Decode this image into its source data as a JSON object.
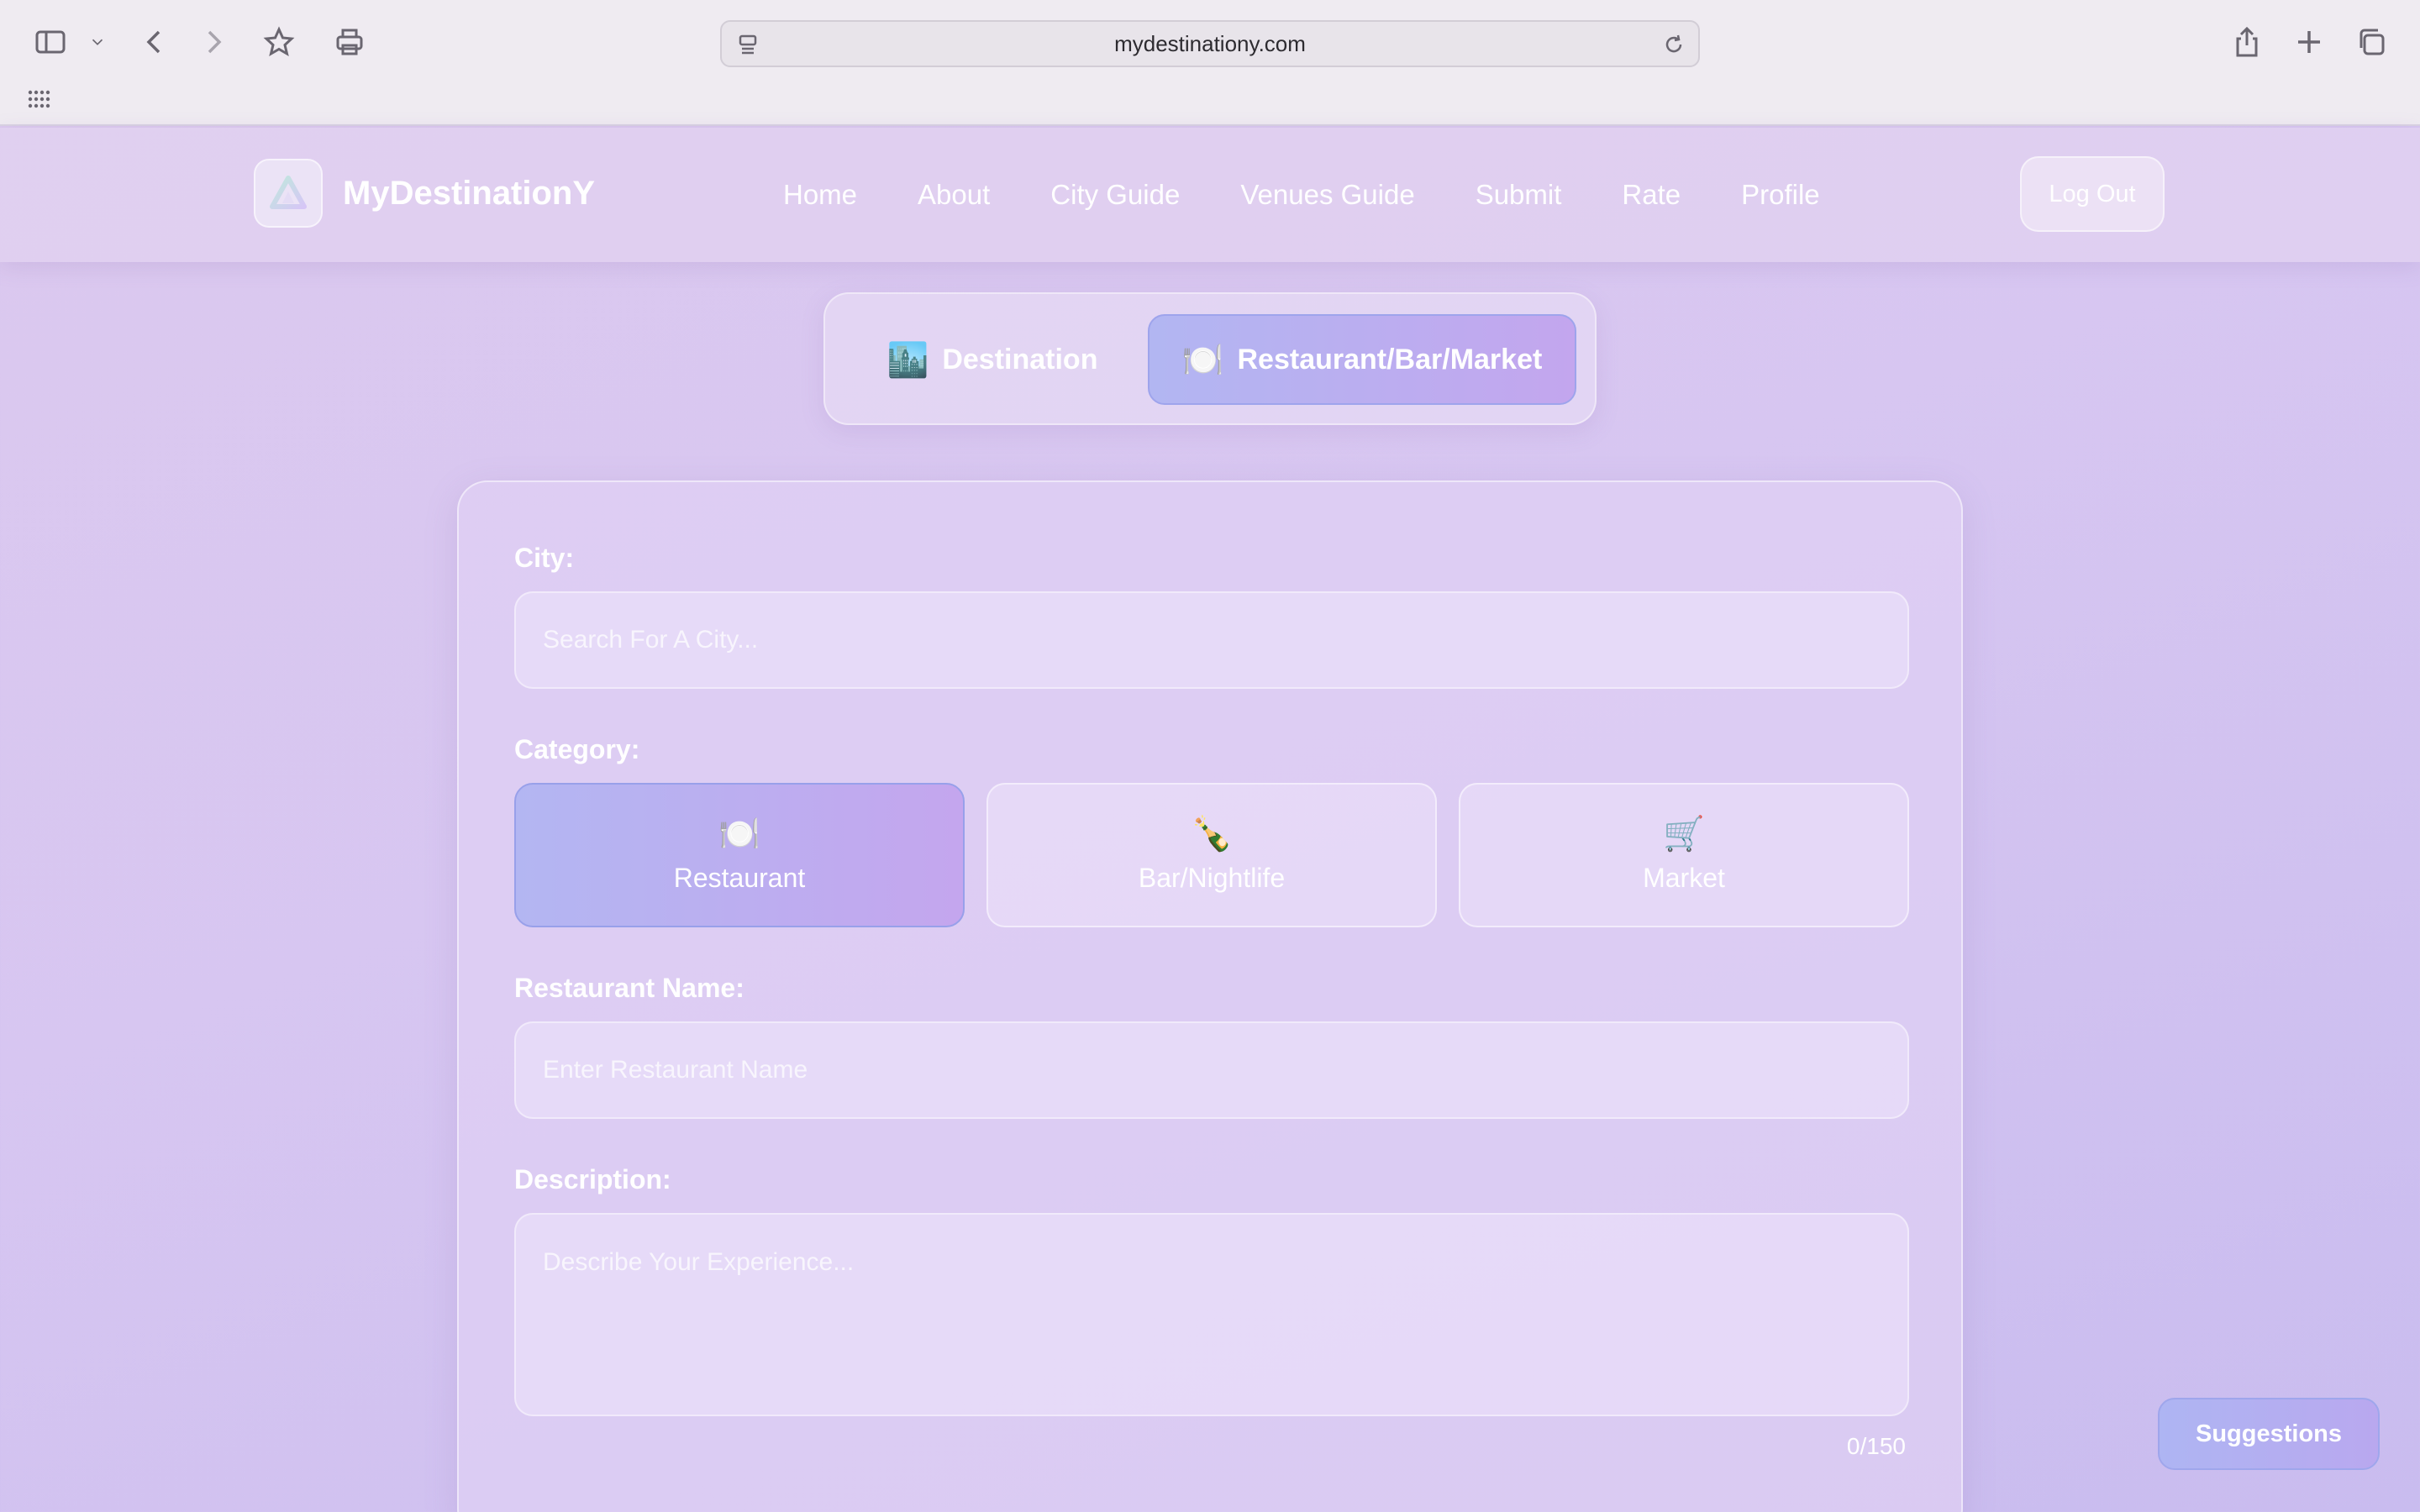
{
  "browser": {
    "url": "mydestinationy.com",
    "icons": [
      "sidebar-icon",
      "chevron-down-icon",
      "back-icon",
      "forward-icon",
      "star-icon",
      "print-icon",
      "share-icon",
      "new-tab-icon",
      "tabs-overview-icon",
      "apps-grid-icon"
    ]
  },
  "header": {
    "brand": "MyDestinationY",
    "nav": [
      "Home",
      "About",
      "City Guide",
      "Venues Guide",
      "Submit",
      "Rate",
      "Profile"
    ],
    "logout": "Log Out"
  },
  "mode_toggle": {
    "options": [
      {
        "emoji": "🏙️",
        "label": "Destination",
        "active": false
      },
      {
        "emoji": "🍽️",
        "label": "Restaurant/Bar/Market",
        "active": true
      }
    ]
  },
  "form": {
    "city_label": "City:",
    "city_placeholder": "Search For A City...",
    "category_label": "Category:",
    "categories": [
      {
        "emoji": "🍽️",
        "label": "Restaurant",
        "active": true
      },
      {
        "emoji": "🍾",
        "label": "Bar/Nightlife",
        "active": false
      },
      {
        "emoji": "🛒",
        "label": "Market",
        "active": false
      }
    ],
    "name_label": "Restaurant Name:",
    "name_placeholder": "Enter Restaurant Name",
    "description_label": "Description:",
    "description_placeholder": "Describe Your Experience...",
    "char_count": "0/150"
  },
  "suggestions": "Suggestions",
  "colors": {
    "accent_start": "#b2b6f2",
    "accent_end": "#c3a6ee",
    "background": "#d7c6f1"
  }
}
